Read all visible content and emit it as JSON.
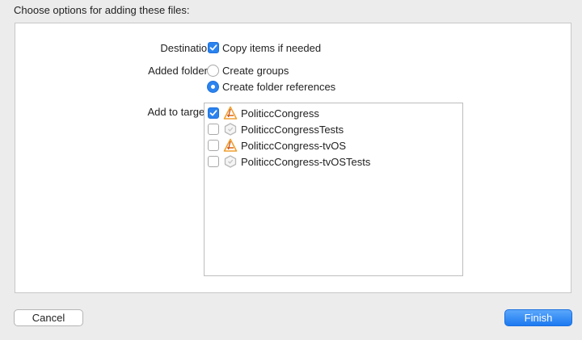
{
  "dialog": {
    "title": "Choose options for adding these files:"
  },
  "destination": {
    "label": "Destination:",
    "option": {
      "label": "Copy items if needed",
      "checked": true
    }
  },
  "added_folders": {
    "label": "Added folders:",
    "options": [
      {
        "label": "Create groups",
        "selected": false
      },
      {
        "label": "Create folder references",
        "selected": true
      }
    ]
  },
  "targets": {
    "label": "Add to targets:",
    "items": [
      {
        "name": "PoliticcCongress",
        "checked": true,
        "icon": "app-target-icon"
      },
      {
        "name": "PoliticcCongressTests",
        "checked": false,
        "icon": "test-bundle-icon"
      },
      {
        "name": "PoliticcCongress-tvOS",
        "checked": false,
        "icon": "app-target-icon"
      },
      {
        "name": "PoliticcCongress-tvOSTests",
        "checked": false,
        "icon": "test-bundle-icon"
      }
    ]
  },
  "buttons": {
    "cancel": "Cancel",
    "finish": "Finish"
  },
  "colors": {
    "accent": "#2a83ee",
    "background": "#ececec",
    "panel": "#ffffff"
  }
}
